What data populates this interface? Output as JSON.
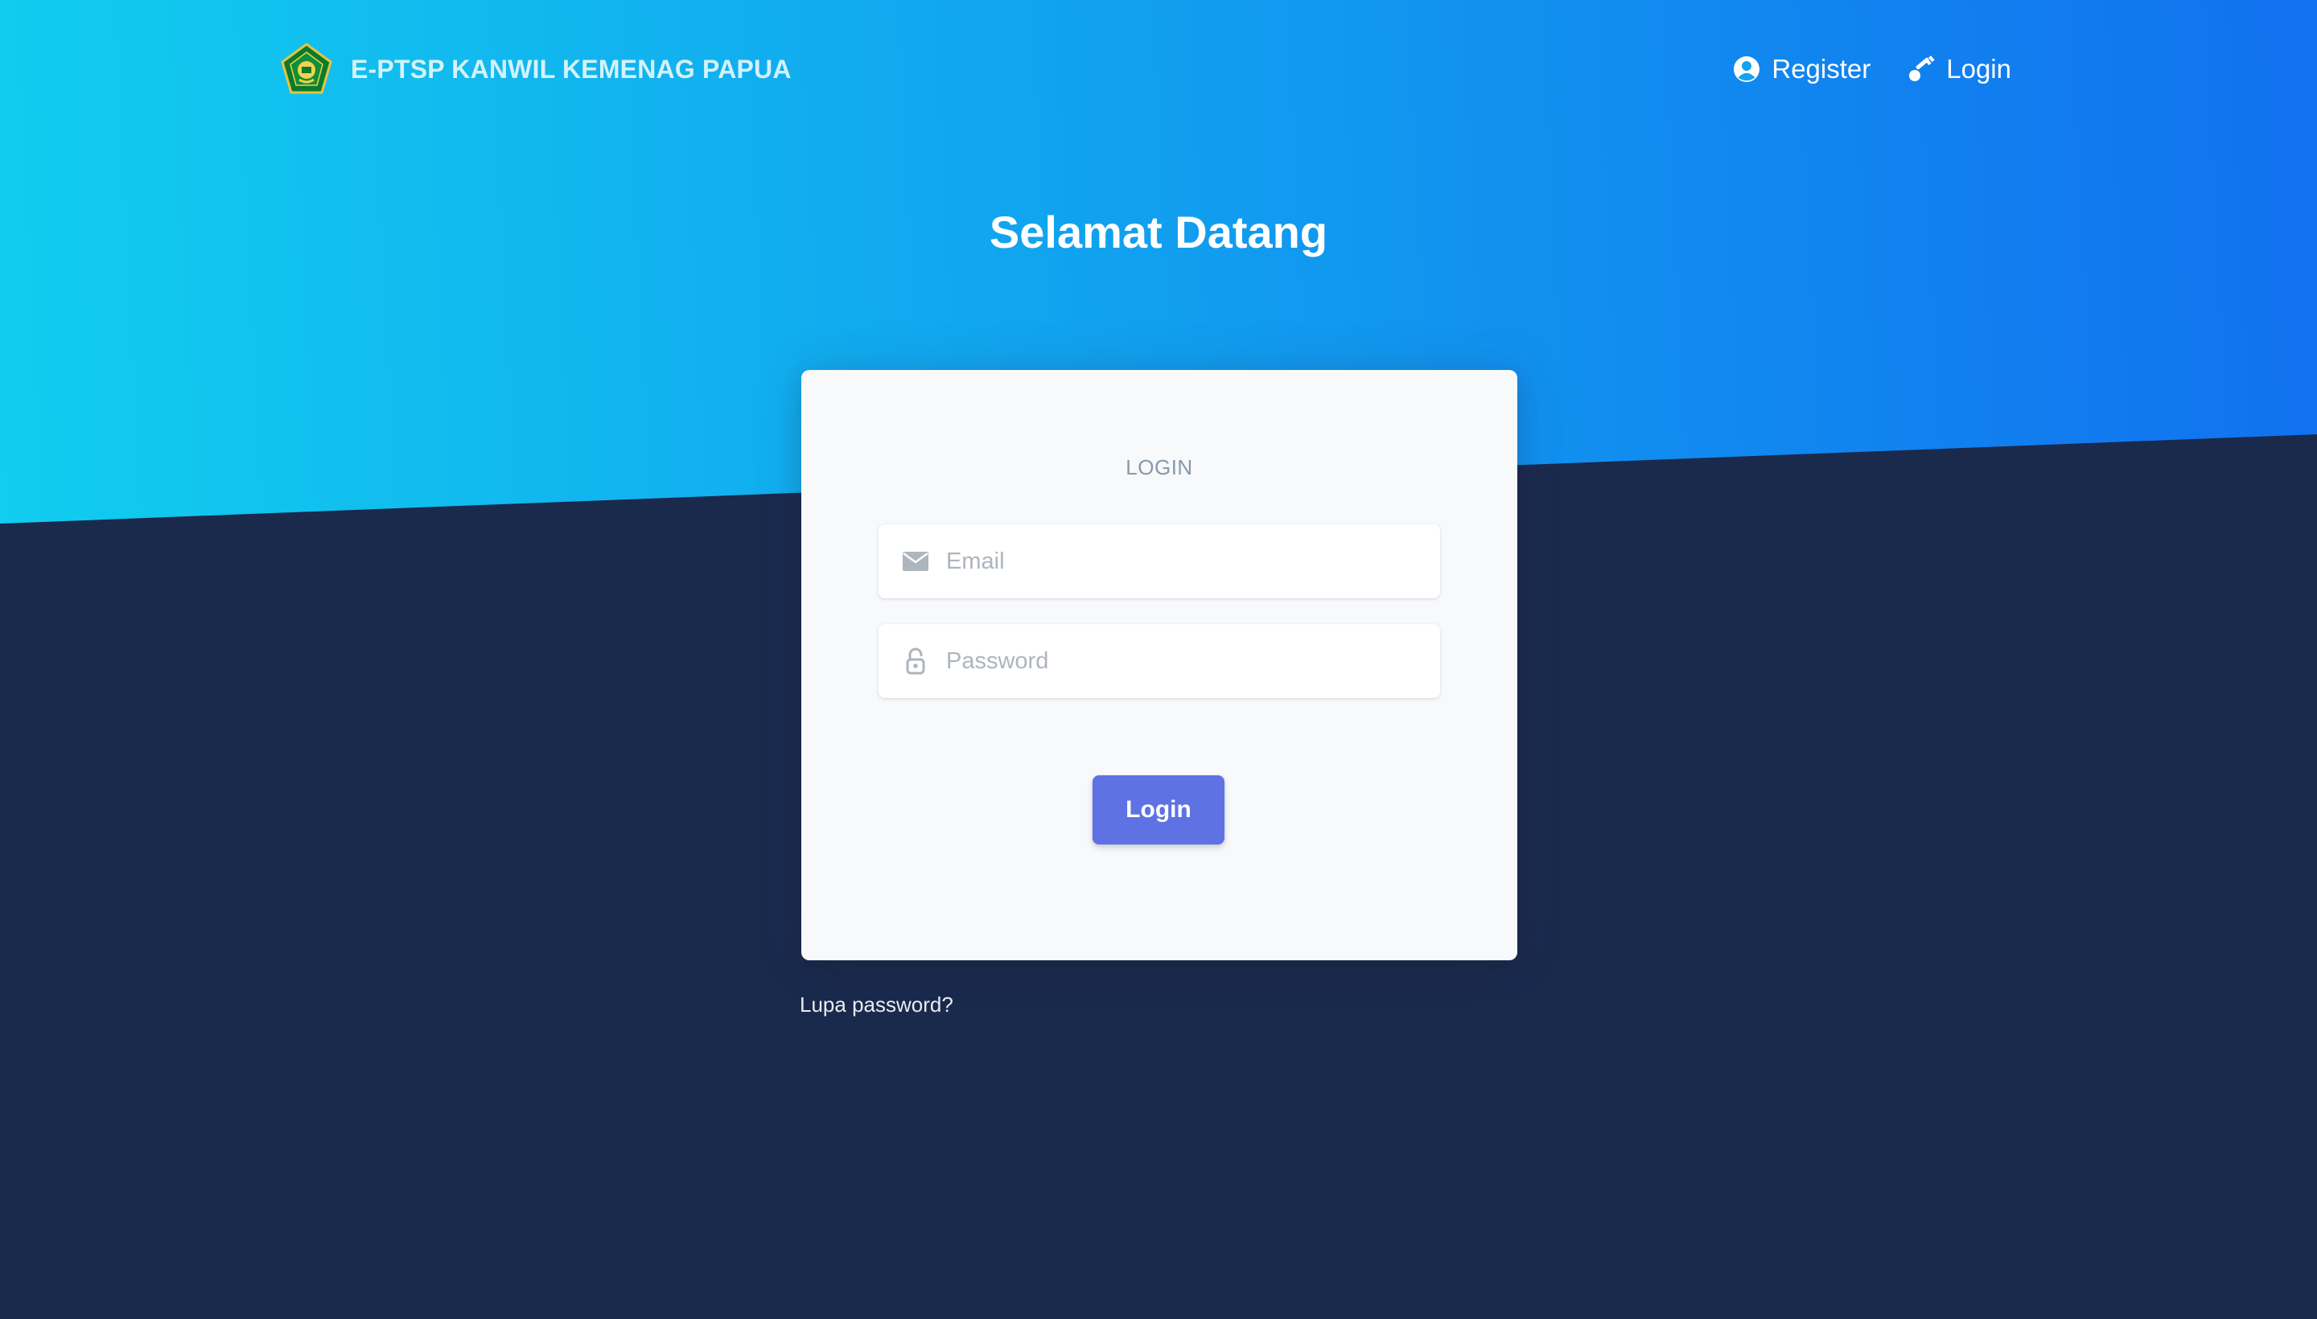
{
  "navbar": {
    "brand_name": "E-PTSP KANWIL KEMENAG PAPUA",
    "brand_logo": "kemenag-emblem-logo",
    "links": [
      {
        "label": "Register",
        "icon": "user-circle-icon"
      },
      {
        "label": "Login",
        "icon": "key-icon"
      }
    ]
  },
  "hero": {
    "title": "Selamat Datang"
  },
  "login_card": {
    "heading": "LOGIN",
    "email": {
      "placeholder": "Email",
      "value": "",
      "icon": "envelope-icon"
    },
    "password": {
      "placeholder": "Password",
      "value": "",
      "icon": "lock-open-icon"
    },
    "submit_label": "Login"
  },
  "footer_links": {
    "forgot_password": "Lupa password?"
  },
  "colors": {
    "hero_gradient_start": "#11cdef",
    "hero_gradient_end": "#1171ef",
    "background": "#1a2a4d",
    "card": "#f7f9fb",
    "primary_button": "#5e72e4",
    "muted_text": "#8898aa"
  }
}
